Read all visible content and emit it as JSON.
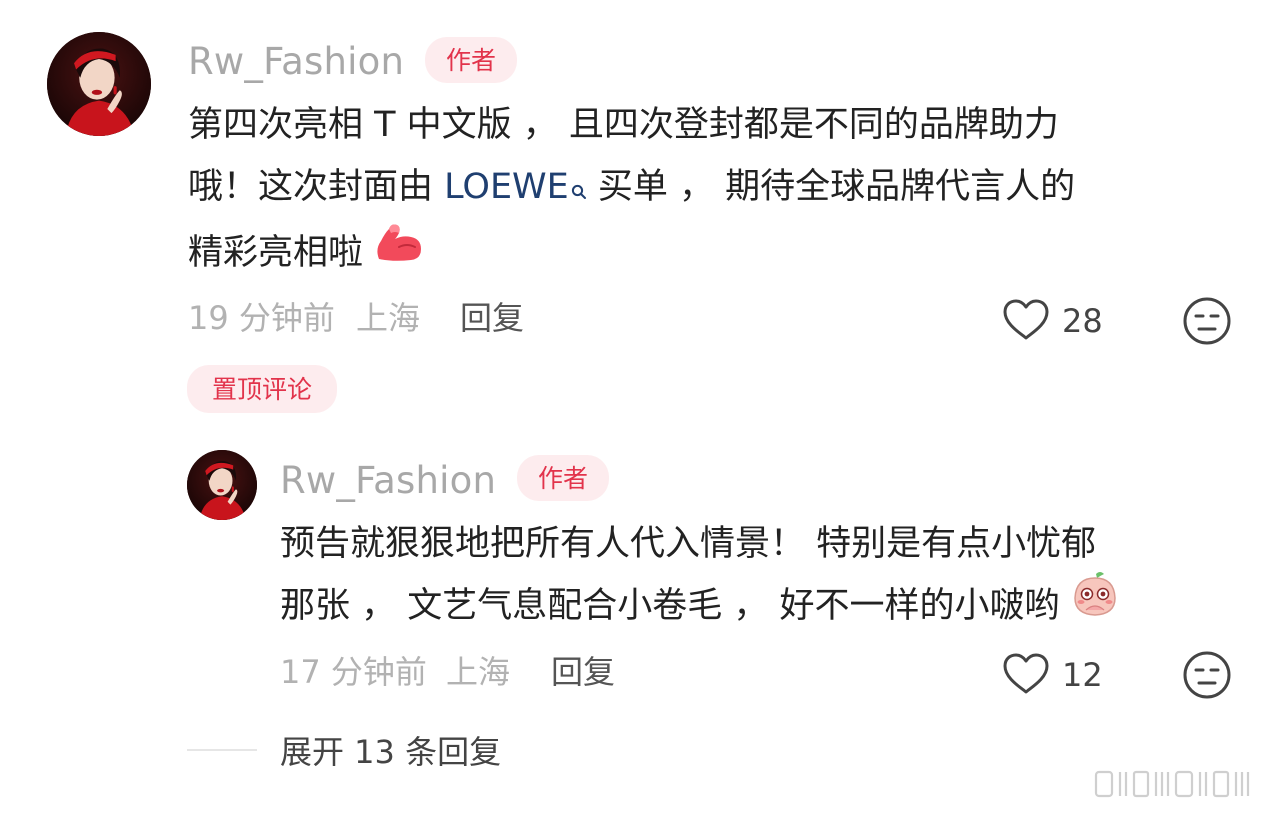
{
  "comment": {
    "username": "Rw_Fashion",
    "author_badge": "作者",
    "line1": "第四次亮相 T 中文版 ， 且四次登封都是不同的品牌助力",
    "line2_before": "哦！这次封面由 ",
    "brand_link": "LOEWE",
    "line2_after": " 买单 ， 期待全球品牌代言人的",
    "line3": "精彩亮相啦",
    "time": "19 分钟前",
    "location": "上海",
    "reply_label": "回复",
    "like_count": "28",
    "pinned_tag": "置顶评论"
  },
  "reply": {
    "username": "Rw_Fashion",
    "author_badge": "作者",
    "line1": "预告就狠狠地把所有人代入情景！ 特别是有点小忧郁",
    "line2": "那张 ， 文艺气息配合小卷毛 ， 好不一样的小啵哟",
    "time": "17 分钟前",
    "location": "上海",
    "reply_label": "回复",
    "like_count": "12"
  },
  "expand": {
    "label": "展开 13 条回复"
  },
  "icons": {
    "like": "heart-outline-icon",
    "dislike": "unamused-face-icon",
    "link_search": "search-icon",
    "emoji_comment": "flexed-biceps-emoji",
    "emoji_reply": "shy-peach-emoji",
    "watermark": "platform-watermark-logo"
  },
  "colors": {
    "badge_text": "#e2334b",
    "badge_bg": "#fdecee",
    "link": "#1f3f70",
    "username": "#a8a8a8",
    "meta": "#b2b2b2"
  }
}
